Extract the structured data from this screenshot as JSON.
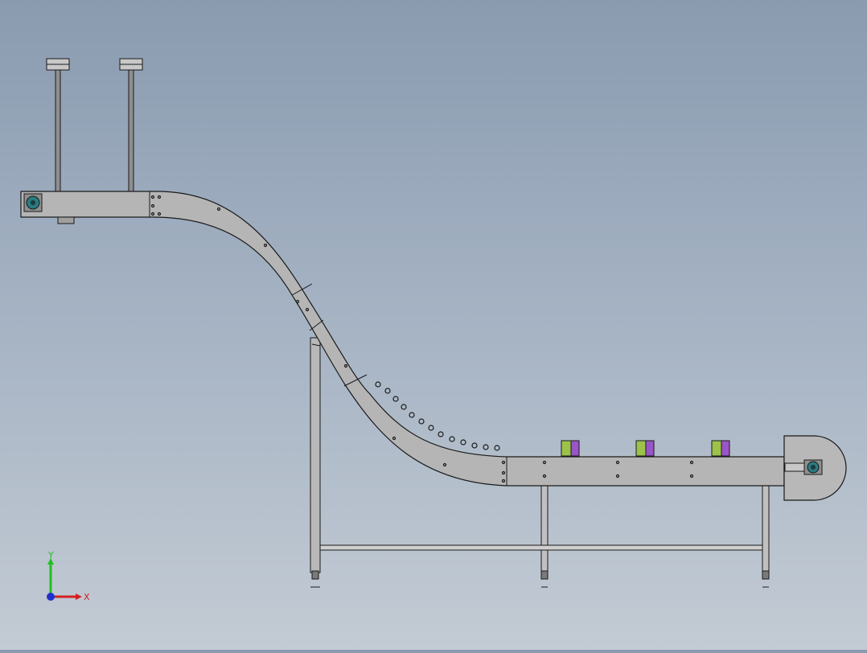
{
  "viewport": {
    "background_top": "#8a9bb0",
    "background_bottom": "#c3cbd4"
  },
  "model": {
    "conveyor_color": "#b5b5b5",
    "edge_color": "#1a1a1a",
    "motor_color": "#2a7a80",
    "cans": [
      {
        "label_color_left": "#9cc24a",
        "label_color_right": "#9a55c8"
      },
      {
        "label_color_left": "#9cc24a",
        "label_color_right": "#9a55c8"
      },
      {
        "label_color_left": "#9cc24a",
        "label_color_right": "#9a55c8"
      }
    ]
  },
  "triad": {
    "x_label": "X",
    "y_label": "Y",
    "x_color": "#d42020",
    "y_color": "#20c020",
    "z_color": "#2030d0"
  }
}
